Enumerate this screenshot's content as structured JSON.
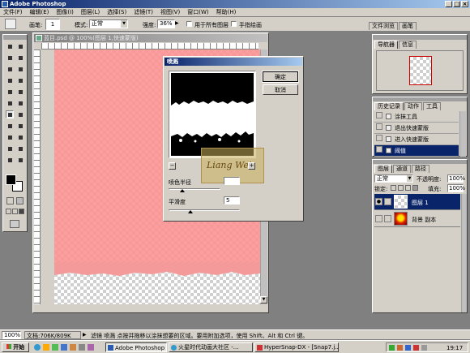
{
  "app": {
    "title": "Adobe Photoshop"
  },
  "menu": [
    "文件(F)",
    "编辑(E)",
    "图像(I)",
    "图层(L)",
    "选择(S)",
    "滤镜(T)",
    "视图(V)",
    "窗口(W)",
    "帮助(H)"
  ],
  "options": {
    "brush_label": "画笔:",
    "brush_size": "1",
    "mode_label": "模式:",
    "mode_value": "正常",
    "opacity_label": "强度:",
    "opacity_value": "36%",
    "all_layers_label": "用于所有图层",
    "finger_label": "手指绘画",
    "palette_tabs": [
      "文件浏览",
      "画笔"
    ]
  },
  "document": {
    "title": "蓝目.psd @ 100%(图层 1,快速蒙版)"
  },
  "dialog": {
    "title": "喷溅",
    "ok_label": "确定",
    "cancel_label": "取消",
    "radius_label": "喷色半径",
    "radius_value": "",
    "smooth_label": "平滑度",
    "smooth_value": "5",
    "zoom_minus": "−",
    "zoom_plus": "+",
    "watermark": "Liang Wei"
  },
  "navigator": {
    "tabs": [
      "导航器",
      "信息"
    ]
  },
  "history": {
    "tabs": [
      "历史记录",
      "动作",
      "工具"
    ],
    "items": [
      "涂抹工具",
      "退出快速蒙版",
      "进入快速蒙版",
      "阈值"
    ]
  },
  "layers": {
    "tabs": [
      "图层",
      "通道",
      "路径"
    ],
    "blend_mode": "正常",
    "opacity_label": "不透明度:",
    "opacity_value": "100%",
    "lock_label": "锁定:",
    "fill_label": "填充:",
    "fill_value": "100%",
    "items": [
      {
        "name": "图层 1"
      },
      {
        "name": "背景 副本"
      }
    ]
  },
  "status": {
    "zoom": "100%",
    "doc_label": "文档:706K/809K",
    "hint": "滤镜 喷溅   点按并拖移以涂抹想要的区域。要用附加选项，使用 Shift、Alt 和 Ctrl 键。"
  },
  "taskbar": {
    "start_label": "开始",
    "tasks": [
      "Adobe Photoshop",
      "火星时代动画大社区 -...",
      "HyperSnap-DX - [Snap7.j..."
    ],
    "clock": "19:17"
  }
}
